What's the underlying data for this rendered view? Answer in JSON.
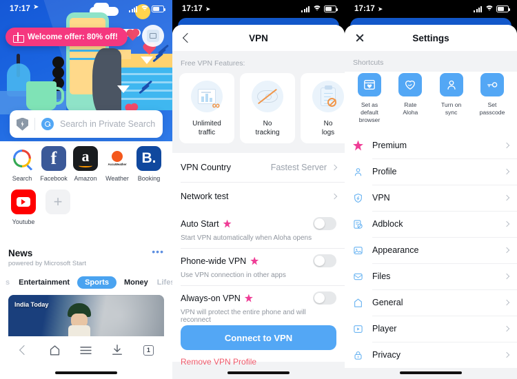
{
  "panels": {
    "home": {
      "status": {
        "time": "17:17",
        "location_icon": "location-arrow-icon"
      },
      "offer": {
        "label": "Welcome offer: 80% off!",
        "icon": "gift-icon",
        "color": "#f5387f"
      },
      "search": {
        "placeholder": "Search in Private Search",
        "shield_icon": "shield-icon",
        "search_icon": "search-icon"
      },
      "shortcuts": [
        {
          "label": "Search",
          "icon": "google-search-icon"
        },
        {
          "label": "Facebook",
          "icon": "facebook-icon"
        },
        {
          "label": "Amazon",
          "icon": "amazon-icon"
        },
        {
          "label": "Weather",
          "icon": "accuweather-icon",
          "sub": "AccuWeather"
        },
        {
          "label": "Booking",
          "icon": "booking-icon",
          "glyph": "B."
        },
        {
          "label": "Youtube",
          "icon": "youtube-icon"
        },
        {
          "label": "",
          "icon": "plus-icon",
          "glyph": "+"
        }
      ],
      "news": {
        "title": "News",
        "subtitle": "powered by Microsoft Start",
        "more_icon": "more-horizontal-icon",
        "tabs": [
          "s",
          "Entertainment",
          "Sports",
          "Money",
          "Lifestyle"
        ],
        "active_tab": "Sports",
        "card_source": "India Today"
      },
      "toolbar": [
        {
          "name": "back",
          "icon": "chevron-left-icon"
        },
        {
          "name": "home",
          "icon": "home-icon"
        },
        {
          "name": "menu",
          "icon": "hamburger-menu-icon"
        },
        {
          "name": "downloads",
          "icon": "download-icon"
        },
        {
          "name": "tabs",
          "icon": "tab-count-icon",
          "count": "1"
        }
      ]
    },
    "vpn": {
      "status": {
        "time": "17:17",
        "location_icon": "location-arrow-icon"
      },
      "nav": {
        "title": "VPN",
        "back_icon": "chevron-left-icon"
      },
      "features_label": "Free VPN Features:",
      "features": [
        {
          "label": "Unlimited\ntraffic",
          "line1": "Unlimited",
          "line2": "traffic",
          "icon": "chart-infinity-icon"
        },
        {
          "label": "No tracking",
          "line1": "No",
          "line2": "tracking",
          "icon": "eye-slash-icon"
        },
        {
          "label": "No logs",
          "line1": "No",
          "line2": "logs",
          "icon": "clipboard-blocked-icon"
        }
      ],
      "rows": [
        {
          "name": "VPN Country",
          "value": "Fastest Server",
          "chevron": true
        },
        {
          "name": "Network test",
          "value": "",
          "chevron": true
        }
      ],
      "toggles": [
        {
          "name": "Auto Start",
          "premium": true,
          "desc": "Start VPN automatically when Aloha opens",
          "on": false
        },
        {
          "name": "Phone-wide VPN",
          "premium": true,
          "desc": "Use VPN connection in other apps",
          "on": false
        },
        {
          "name": "Always-on VPN",
          "premium": true,
          "desc": "VPN will protect the entire phone and will reconnect",
          "on": false
        }
      ],
      "cta_label": "Connect to VPN",
      "cta_color": "#53a7f5",
      "remove_label": "Remove VPN Profile",
      "remove_color": "#f05a6b"
    },
    "settings": {
      "status": {
        "time": "17:17",
        "location_icon": "location-arrow-icon"
      },
      "nav": {
        "title": "Settings",
        "close_icon": "close-icon"
      },
      "shortcuts_label": "Shortcuts",
      "shortcuts": [
        {
          "line1": "Set as default",
          "line2": "browser",
          "icon": "default-browser-icon"
        },
        {
          "line1": "Rate",
          "line2": "Aloha",
          "icon": "heart-shield-icon"
        },
        {
          "line1": "Turn on",
          "line2": "sync",
          "icon": "person-icon"
        },
        {
          "line1": "Set",
          "line2": "passcode",
          "icon": "key-icon"
        }
      ],
      "items": [
        {
          "label": "Premium",
          "icon": "star-icon",
          "color": "#ef3d96"
        },
        {
          "label": "Profile",
          "icon": "person-icon",
          "color": "#6ab4f2"
        },
        {
          "label": "VPN",
          "icon": "shield-icon",
          "color": "#6ab4f2"
        },
        {
          "label": "Adblock",
          "icon": "adblock-icon",
          "color": "#6ab4f2"
        },
        {
          "label": "Appearance",
          "icon": "image-icon",
          "color": "#6ab4f2"
        },
        {
          "label": "Files",
          "icon": "inbox-icon",
          "color": "#6ab4f2"
        },
        {
          "label": "General",
          "icon": "home-icon",
          "color": "#6ab4f2"
        },
        {
          "label": "Player",
          "icon": "player-icon",
          "color": "#6ab4f2"
        },
        {
          "label": "Privacy",
          "icon": "lock-icon",
          "color": "#6ab4f2"
        }
      ]
    }
  }
}
